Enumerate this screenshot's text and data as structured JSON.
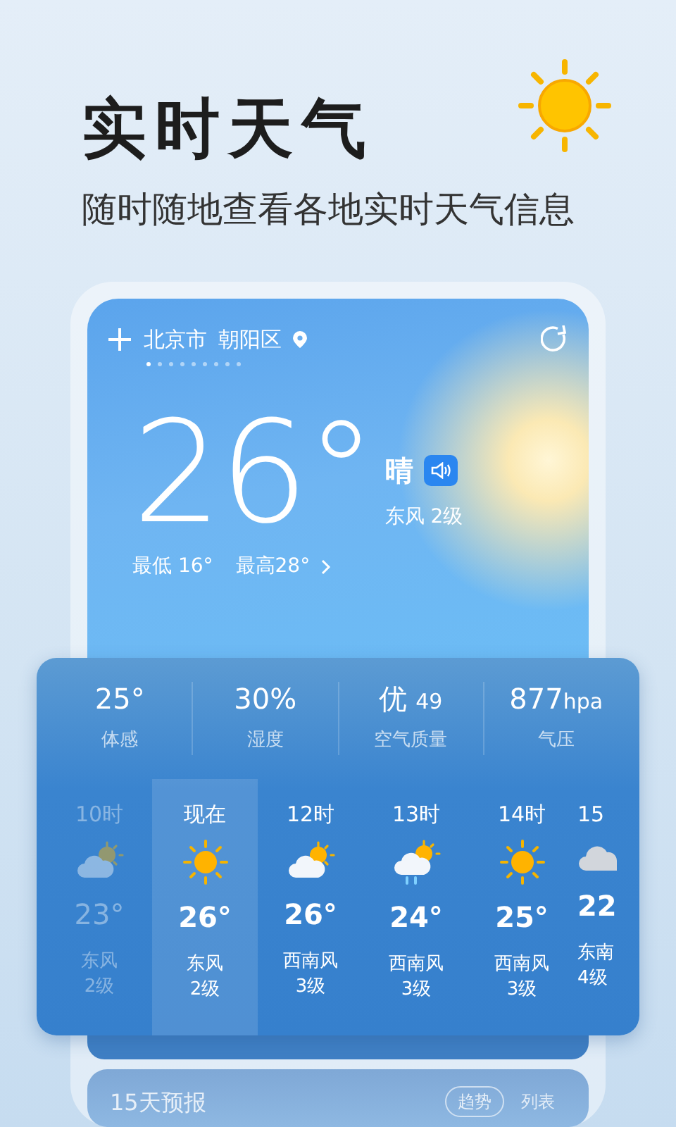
{
  "headline": {
    "title": "实时天气",
    "subtitle": "随时随地查看各地实时天气信息"
  },
  "location": {
    "city": "北京市",
    "district": "朝阳区"
  },
  "pages": [
    {
      "selected": true
    },
    {
      "selected": false
    },
    {
      "selected": false
    },
    {
      "selected": false
    },
    {
      "selected": false
    },
    {
      "selected": false
    },
    {
      "selected": false
    },
    {
      "selected": false
    },
    {
      "selected": false
    }
  ],
  "current": {
    "temperature": "26°",
    "condition": "晴",
    "wind": "东风 2级",
    "low": "最低 16°",
    "high": "最高28°"
  },
  "stats": [
    {
      "value": "25°",
      "label": "体感"
    },
    {
      "value": "30%",
      "label": "湿度"
    },
    {
      "value": "优",
      "suffix": "49",
      "label": "空气质量"
    },
    {
      "value": "877",
      "suffix": "hpa",
      "label": "气压"
    }
  ],
  "hourly": [
    {
      "time": "10时",
      "kind": "partly_cloudy",
      "temp": "23°",
      "wind": "东风",
      "level": "2级",
      "past": true,
      "selected": false
    },
    {
      "time": "现在",
      "kind": "sunny",
      "temp": "26°",
      "wind": "东风",
      "level": "2级",
      "past": false,
      "selected": true
    },
    {
      "time": "12时",
      "kind": "partly_cloudy",
      "temp": "26°",
      "wind": "西南风",
      "level": "3级",
      "past": false,
      "selected": false
    },
    {
      "time": "13时",
      "kind": "shower",
      "temp": "24°",
      "wind": "西南风",
      "level": "3级",
      "past": false,
      "selected": false
    },
    {
      "time": "14时",
      "kind": "sunny",
      "temp": "25°",
      "wind": "西南风",
      "level": "3级",
      "past": false,
      "selected": false
    },
    {
      "time": "15",
      "kind": "cloudy",
      "temp": "22",
      "wind": "东南",
      "level": "4级",
      "past": false,
      "selected": false
    }
  ],
  "forecast": {
    "title": "15天预报",
    "views": [
      {
        "label": "趋势",
        "selected": true
      },
      {
        "label": "列表",
        "selected": false
      }
    ]
  }
}
